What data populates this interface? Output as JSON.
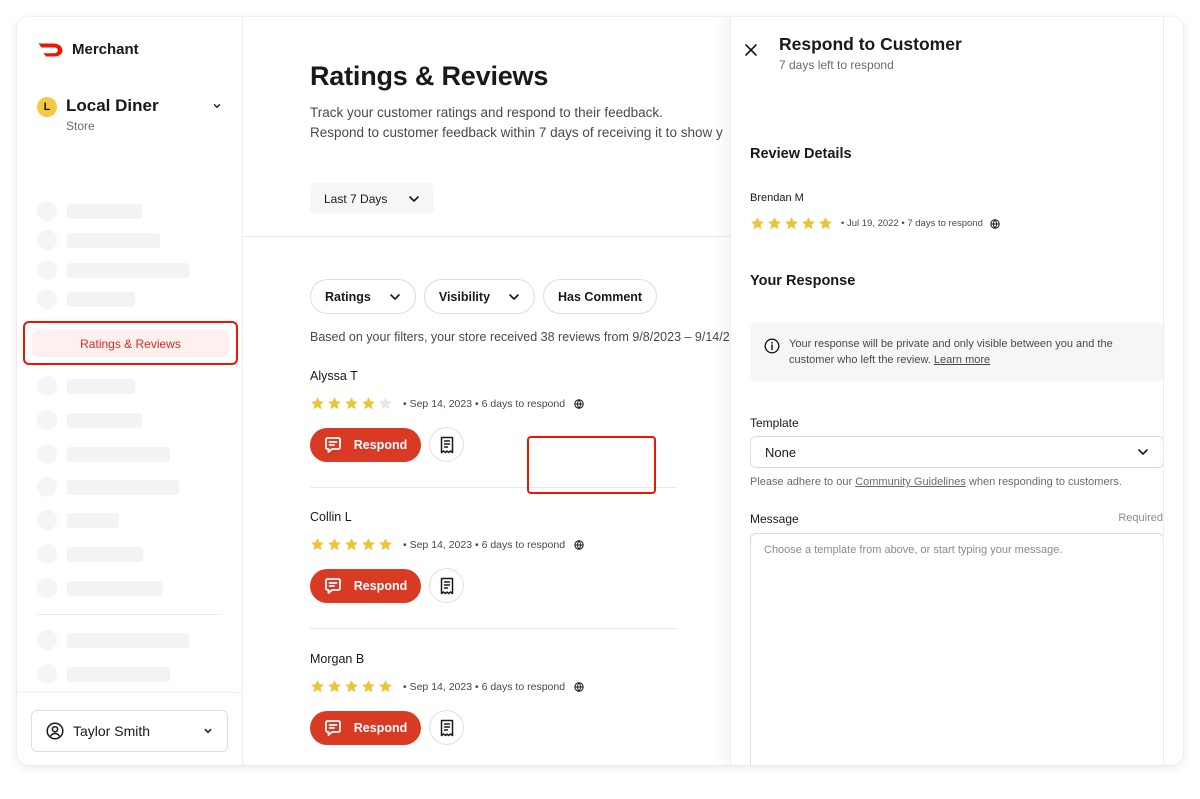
{
  "brand": {
    "name": "Merchant",
    "color": "#eb1700"
  },
  "store": {
    "initial": "L",
    "name": "Local Diner",
    "type": "Store"
  },
  "sidebar": {
    "active_item": "Ratings & Reviews",
    "user": {
      "name": "Taylor Smith"
    }
  },
  "main": {
    "title": "Ratings & Reviews",
    "description_line1": "Track your customer ratings and respond to their feedback.",
    "description_line2": "Respond to customer feedback within 7 days of receiving it to show y",
    "date_range": "Last 7 Days",
    "filters": [
      {
        "label": "Ratings",
        "has_dropdown": true
      },
      {
        "label": "Visibility",
        "has_dropdown": true
      },
      {
        "label": "Has Comment",
        "has_dropdown": false
      }
    ],
    "summary": "Based on your filters, your store received 38 reviews from 9/8/2023 – 9/14/2",
    "reviews": [
      {
        "name": "Alyssa T",
        "rating": 4,
        "meta": "• Sep 14, 2023 • 6 days to respond",
        "respond_label": "Respond"
      },
      {
        "name": "Collin L",
        "rating": 5,
        "meta": "• Sep 14, 2023 • 6 days to respond",
        "respond_label": "Respond"
      },
      {
        "name": "Morgan B",
        "rating": 5,
        "meta": "• Sep 14, 2023 • 6 days to respond",
        "respond_label": "Respond"
      }
    ]
  },
  "panel": {
    "title": "Respond to Customer",
    "subtitle": "7 days left to respond",
    "review_details_title": "Review Details",
    "review": {
      "name": "Brendan M",
      "rating": 5,
      "meta": "• Jul 19, 2022 • 7 days to respond"
    },
    "your_response_title": "Your Response",
    "info_text": "Your response will be private and only visible between you and the customer who left the review.",
    "info_link": "Learn more",
    "template_label": "Template",
    "template_value": "None",
    "guidelines_prefix": "Please adhere to our",
    "guidelines_link": "Community Guidelines",
    "guidelines_suffix": "when responding to customers.",
    "message_label": "Message",
    "message_required": "Required",
    "message_placeholder": "Choose a template from above, or start typing your message.",
    "message_value": ""
  },
  "colors": {
    "accent": "#d93a24",
    "star": "#e8c53a",
    "star_empty": "#e6e6e6"
  }
}
